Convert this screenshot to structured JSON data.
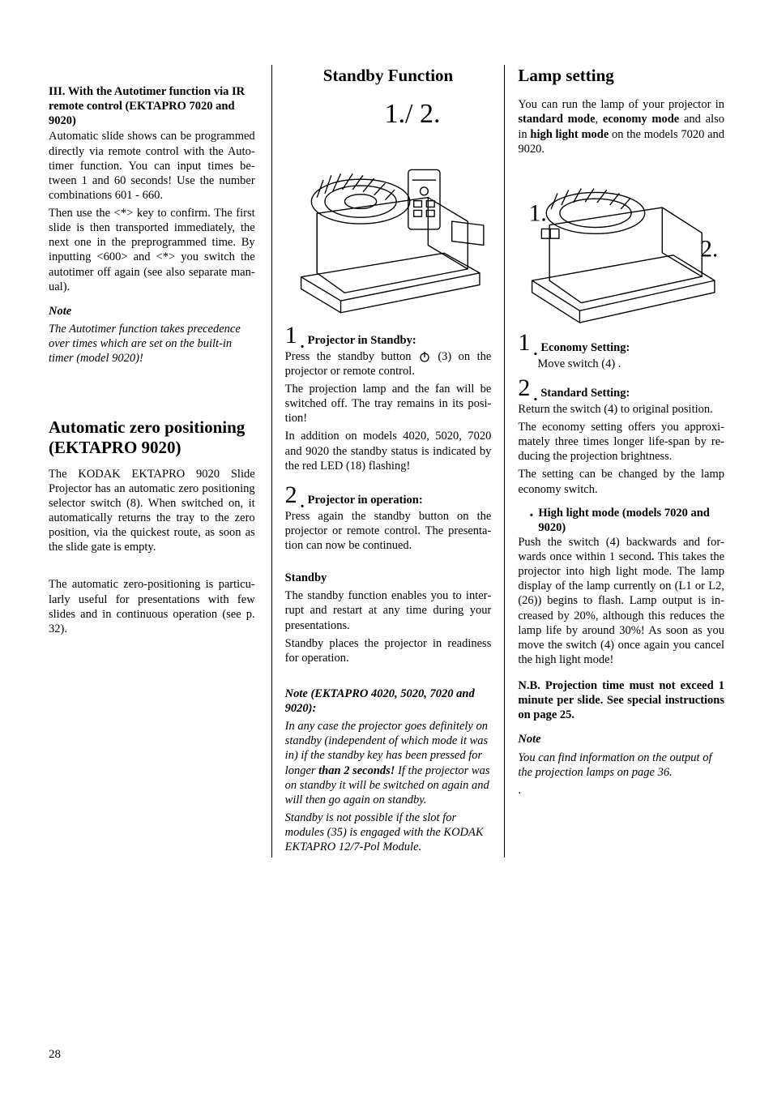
{
  "col1": {
    "autotimer": {
      "title": "III. With the Autotimer function via IR remote control (EKTAPRO 7020 and 9020)",
      "p1": "Automatic slide shows can be programmed directly via remote control with the Auto­timer function. You can input times be­tween 1 and 60 seconds! Use the number combinations 601 - 660.",
      "p2": "Then use the <*> key to confirm. The first slide is then transported immediately, the next one in the preprogrammed time. By inputting <600> and <*> you switch the autotimer off again (see also separate man­ual).",
      "note_label": "Note",
      "note_body": "The Autotimer function takes prece­dence over times which are set on the built-in timer (model 9020)!"
    },
    "autozero": {
      "title": "Automatic zero positioning (EKTAPRO 9020)",
      "p1": "The KODAK EKTAPRO 9020 Slide Projec­tor has an automatic zero positioning selec­tor switch (8). When switched on, it auto­matically returns the tray to the zero position, via the quickest route, as soon as the slide gate is empty.",
      "p2": "The automatic zero-positioning is particu­larly useful for presentations with few slides and in continuous operation (see p. 32)."
    }
  },
  "col2": {
    "title": "Standby Function",
    "fig_label": "1./ 2.",
    "step1": {
      "num": "1",
      "head": "Projector in Standby:",
      "symbol_text": "Press the standby button ",
      "symbol_after": "(3) on the projector or remote control.",
      "p2": "The projection lamp and the fan will be switched off. The tray remains in its posi­tion!",
      "p3": "In addition on models 4020, 5020, 7020 and 9020 the standby status is indicated by the red LED (18) flashing!"
    },
    "step2": {
      "num": "2",
      "head": "Projector in operation:",
      "p1": "Press again the standby button on the projector or remote control. The presenta­tion can now be continued."
    },
    "standby": {
      "head": "Standby",
      "p1": "The standby function enables you to inter­rupt and restart at any time during your presentations.",
      "p2": "Standby places the projector in readiness for operation."
    },
    "note": {
      "head": "Note (EKTAPRO 4020, 5020, 7020 and 9020):",
      "body": "In any case the projector goes definitely on standby (independent of which mode it was in)  if the standby key has been pressed for longer than 2 seconds! If the projector was on standby it will be switched on again and will then go again on standby.",
      "body2": "Standby is not possible if the slot for modules (35)  is engaged with the KODAK EKTAPRO 12/7-Pol Module."
    }
  },
  "col3": {
    "title": "Lamp setting",
    "intro": "You can run the lamp of your projector in standard mode, economy mode and also in high light mode on the models 7020 and 9020.",
    "fig_label1": "1.",
    "fig_label2": "2.",
    "step1": {
      "num": "1",
      "head": "Economy Setting:",
      "body": "Move switch (4) ."
    },
    "step2": {
      "num": "2",
      "head": "Standard Setting:",
      "p1": "Return the switch (4) to original position.",
      "p2": "The economy setting offers you approxi­mately three times longer life-span by re­ducing the projection brightness.",
      "p3": "The setting can be changed by the lamp economy switch."
    },
    "hlm": {
      "head": "High light mode (models 7020 and 9020)",
      "body": "Push the switch (4) backwards and for­wards once within 1 second. This takes the projector into high light mode. The lamp display of the lamp currently on (L1 or L2, (26)) begins to flash. Lamp output is in­creased by 20%, although this reduces the lamp life by around 30%! As soon as you move the switch (4) once again you cancel the high light mode!"
    },
    "nb": "N.B. Projection time must not exceed 1 minute per slide. See special instructions on page 25.",
    "note_label": "Note",
    "note_body": "You can find information on the output of the projection lamps on page 36."
  },
  "page": "28"
}
